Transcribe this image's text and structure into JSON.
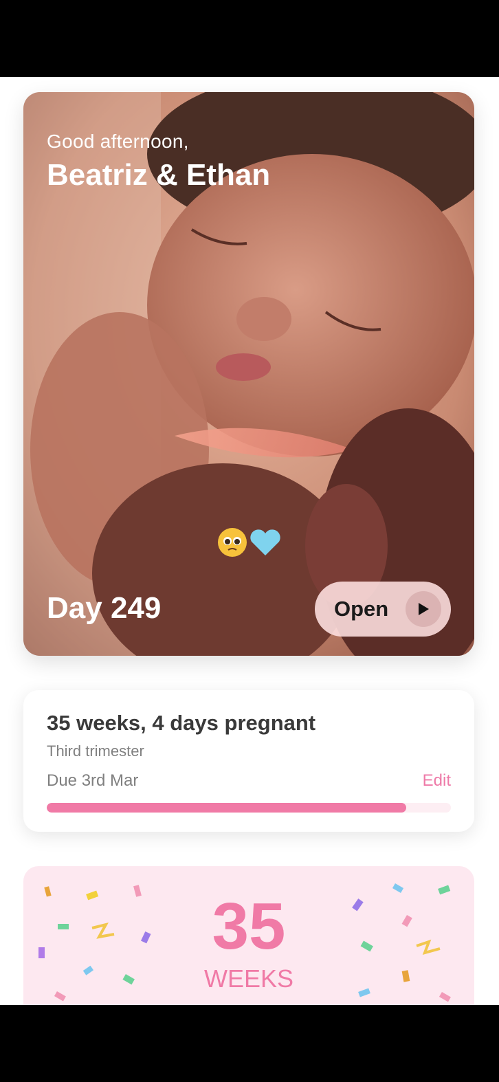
{
  "hero": {
    "greeting": "Good afternoon,",
    "names": "Beatriz & Ethan",
    "emoji": "🥹🩵",
    "day_label": "Day 249",
    "open_label": "Open"
  },
  "pregnancy": {
    "weeks_text": "35 weeks, 4 days pregnant",
    "trimester": "Third trimester",
    "due_text": "Due 3rd Mar",
    "edit_label": "Edit",
    "progress": 0.89
  },
  "milestone": {
    "number": "35",
    "unit": "WEEKS"
  },
  "colors": {
    "accent_pink": "#f07aa6",
    "card_background": "#fde8f0"
  },
  "icons": [
    "play-icon",
    "pleading-face-emoji",
    "light-blue-heart-emoji"
  ]
}
